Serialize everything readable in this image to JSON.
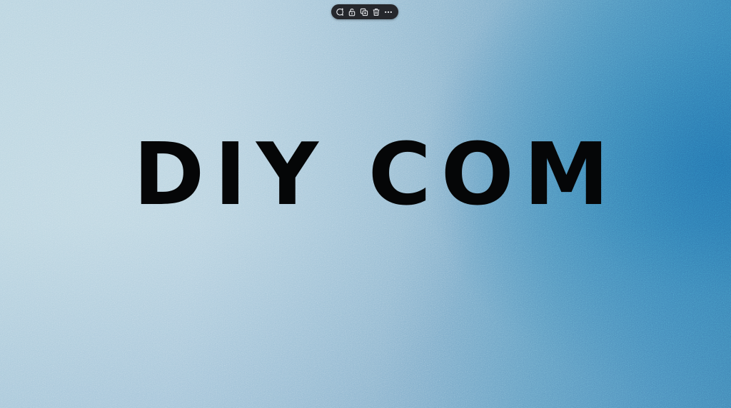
{
  "canvas": {
    "headline": "DIY COM",
    "background_colors": [
      "#b6d2de",
      "#8fb7cf",
      "#2f78ae"
    ],
    "text_color": "#050607"
  },
  "toolbar": {
    "background": "#25272c",
    "icon_color": "#e6e8ec",
    "buttons": [
      {
        "icon": "comment-add-icon"
      },
      {
        "icon": "unlock-icon"
      },
      {
        "icon": "duplicate-icon"
      },
      {
        "icon": "trash-icon"
      },
      {
        "icon": "more-options-icon"
      }
    ]
  }
}
